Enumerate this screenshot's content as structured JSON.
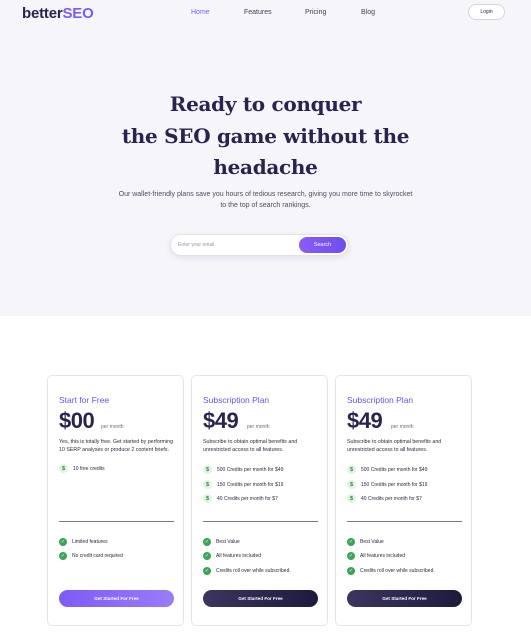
{
  "brand": {
    "part1": "better",
    "part2": "SEO"
  },
  "nav": {
    "items": [
      "Home",
      "Features",
      "Pricing",
      "Blog"
    ],
    "active": "Home",
    "login_label": "Login"
  },
  "hero": {
    "title_lines": [
      "Ready to conquer",
      "the SEO game without the",
      "headache"
    ],
    "subtitle": "Our wallet-friendly plans save you hours of tedious research, giving you more time to skyrocket to the top of search rankings.",
    "search_placeholder": "Enter your email",
    "search_button": "Search"
  },
  "plans": [
    {
      "title": "Start for Free",
      "price": "$00",
      "period": "per month",
      "description": "Yes, this is totally free. Get started by performing 10 SERP analyses or produce 2 content briefs.",
      "credits": [
        "10 free credits"
      ],
      "features": [
        "Limited features",
        "No credit card required"
      ],
      "cta": "Get Started For Free"
    },
    {
      "title": "Subscription Plan",
      "price": "$49",
      "period": "per month",
      "description": "Subscribe to obtain optimal benefits and unrestricted access to all features.",
      "credits": [
        "500 Credits per month for $49",
        "150 Credits per month for $19",
        "40 Credits per month for $7"
      ],
      "features": [
        "Best Value",
        "All features included",
        "Credits roll over while subscribed"
      ],
      "cta": "Get Started For Free"
    },
    {
      "title": "Subscription Plan",
      "price": "$49",
      "period": "per month",
      "description": "Subscribe to obtain optimal benefits and unrestricted access to all features.",
      "credits": [
        "500 Credits per month for $49",
        "150 Credits per month for $19",
        "40 Credits per month for $7"
      ],
      "features": [
        "Best Value",
        "All features included",
        "Credits roll over while subscribed"
      ],
      "cta": "Get Started For Free"
    }
  ],
  "icons": {
    "credit": "dollar-icon",
    "feature": "check-icon"
  },
  "colors": {
    "accent": "#7b5cf5",
    "brand_dark": "#2a2350",
    "success": "#3aa55a",
    "hero_bg": "#f6f5f9"
  }
}
